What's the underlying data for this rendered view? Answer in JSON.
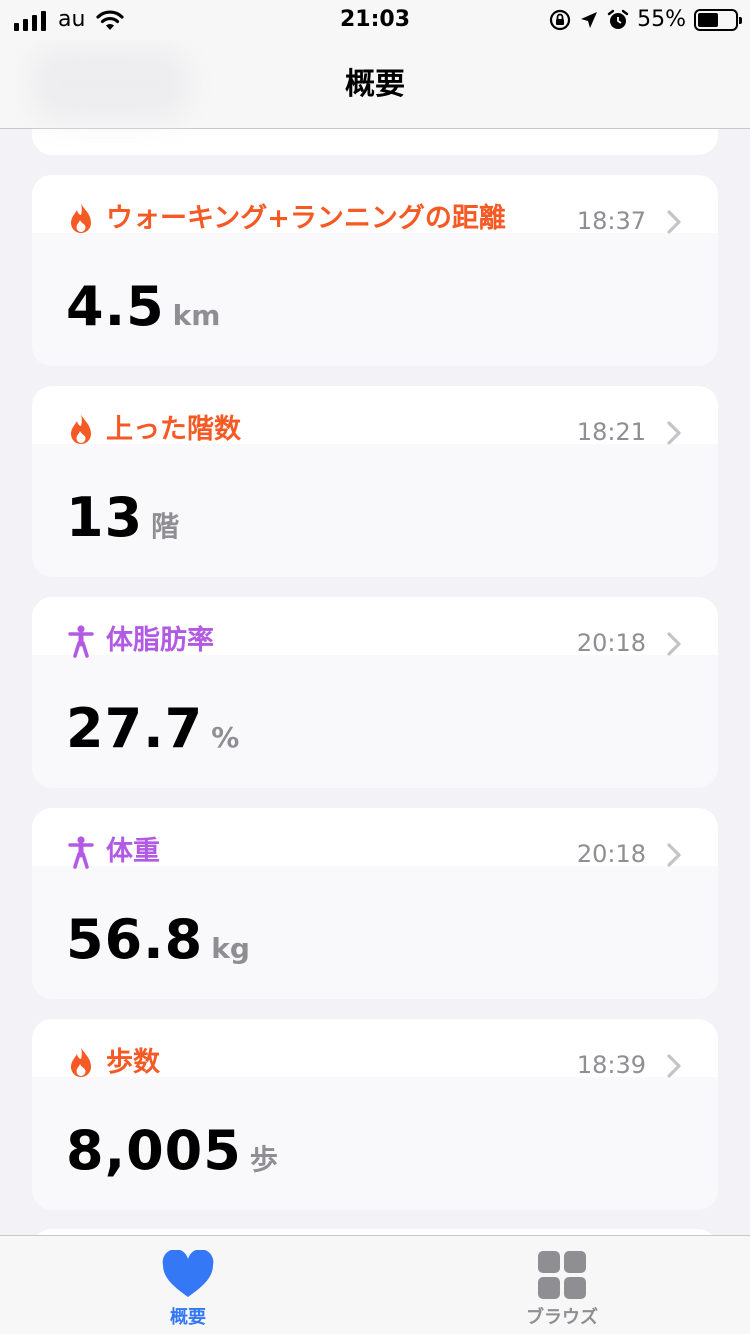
{
  "status_bar": {
    "carrier": "au",
    "time": "21:03",
    "battery_percent": "55%",
    "battery_level": 0.55
  },
  "nav": {
    "title": "概要"
  },
  "colors": {
    "activity_orange": "#f55a24",
    "body_purple": "#b25ae3",
    "tab_active_blue": "#3478f6",
    "secondary_gray": "#8e8e93"
  },
  "metrics": [
    {
      "name": "ウォーキング+ランニングの距離",
      "time": "18:37",
      "value": "4.5",
      "unit": "km",
      "icon": "flame-icon",
      "color": "#f55a24"
    },
    {
      "name": "上った階数",
      "time": "18:21",
      "value": "13",
      "unit": "階",
      "icon": "flame-icon",
      "color": "#f55a24"
    },
    {
      "name": "体脂肪率",
      "time": "20:18",
      "value": "27.7",
      "unit": "%",
      "icon": "person-figure-icon",
      "color": "#b25ae3"
    },
    {
      "name": "体重",
      "time": "20:18",
      "value": "56.8",
      "unit": "kg",
      "icon": "person-figure-icon",
      "color": "#b25ae3"
    },
    {
      "name": "歩数",
      "time": "18:39",
      "value": "8,005",
      "unit": "歩",
      "icon": "flame-icon",
      "color": "#f55a24"
    }
  ],
  "tab_bar": {
    "tabs": [
      {
        "label": "概要",
        "icon": "heart-icon",
        "active": true
      },
      {
        "label": "ブラウズ",
        "icon": "grid-icon",
        "active": false
      }
    ]
  }
}
